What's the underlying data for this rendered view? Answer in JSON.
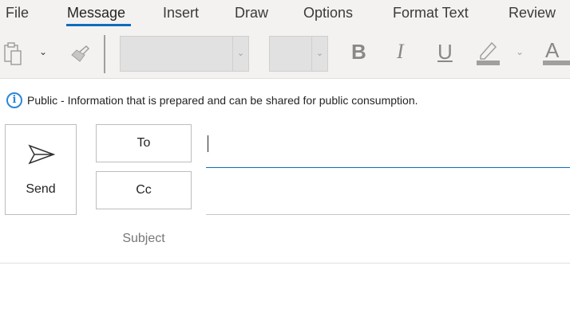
{
  "tabs": [
    "File",
    "Message",
    "Insert",
    "Draw",
    "Options",
    "Format Text",
    "Review"
  ],
  "active_tab": "Message",
  "toolbar": {
    "bold": "B",
    "italic": "I",
    "underline": "U",
    "font_color": "A",
    "font_name": "",
    "font_size": ""
  },
  "info": {
    "text": "Public - Information that is prepared and can be shared for public consumption."
  },
  "compose": {
    "send_label": "Send",
    "to_label": "To",
    "cc_label": "Cc",
    "subject_label": "Subject",
    "to_value": "",
    "cc_value": "",
    "subject_value": ""
  },
  "colors": {
    "accent": "#0f6cbd",
    "info": "#2b88d8"
  }
}
